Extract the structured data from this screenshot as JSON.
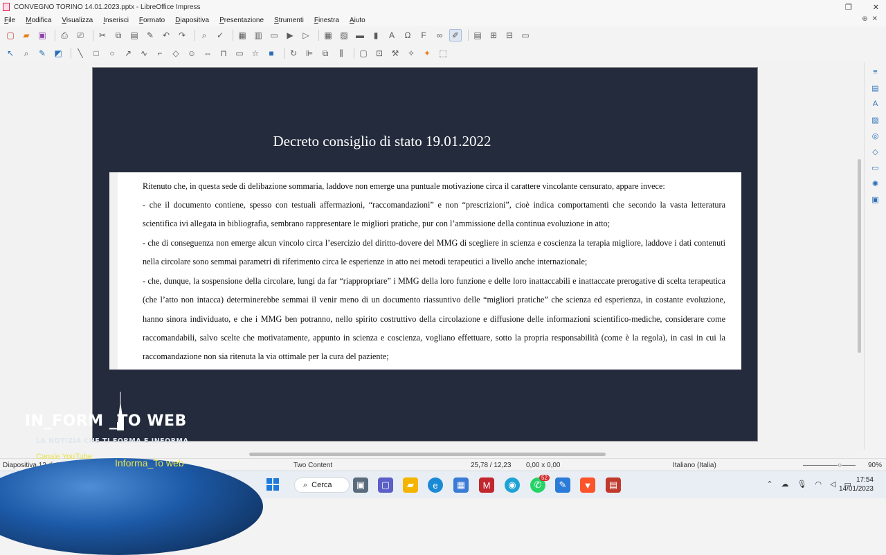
{
  "window": {
    "title": "CONVEGNO TORINO 14.01.2023.pptx - LibreOffice Impress",
    "controls": [
      "❐",
      "✕"
    ]
  },
  "menu": [
    "File",
    "Modifica",
    "Visualizza",
    "Inserisci",
    "Formato",
    "Diapositiva",
    "Presentazione",
    "Strumenti",
    "Finestra",
    "Aiuto"
  ],
  "slide": {
    "title": "Decreto consiglio di stato 19.01.2022",
    "paragraphs": [
      "Ritenuto che, in questa sede di delibazione sommaria, laddove non emerge una puntuale motivazione circa il carattere vincolante censurato, appare invece:",
      "- che il documento contiene, spesso con testuali affermazioni, “raccomandazioni” e non “prescrizioni”, cioè indica comportamenti che secondo la vasta letteratura scientifica ivi allegata in bibliografia, sembrano rappresentare le migliori pratiche, pur con l’ammissione della continua evoluzione in atto;",
      "- che di conseguenza non emerge alcun vincolo circa l’esercizio del diritto-dovere del MMG di scegliere in scienza e coscienza la terapia migliore, laddove i dati contenuti nella circolare sono semmai parametri di riferimento circa le esperienze in atto nei metodi terapeutici a livello anche internazionale;",
      "- che, dunque, la sospensione della circolare, lungi da far “riappropriare” i MMG della loro funzione e delle loro inattaccabili e inattaccate prerogative di scelta terapeutica (che l’atto non intacca) determinerebbe semmai il venir meno di un documento riassuntivo delle “migliori pratiche” che scienza ed esperienza, in costante evoluzione, hanno sinora individuato, e che i MMG ben potranno, nello spirito costruttivo della circolazione e diffusione delle informazioni scientifico-mediche, considerare come raccomandabili, salvo scelte che motivatamente, appunto in scienza e coscienza, vogliano effettuare, sotto la propria responsabilità (come è la regola), in casi in cui la raccomandazione non sia ritenuta la via ottimale per la cura del paziente;"
    ]
  },
  "status": {
    "slide_info": "Diapositiva 12 di 17",
    "layout": "Two Content",
    "position": "25,78 / 12,23",
    "size": "0,00 x 0,00",
    "language": "Italiano (Italia)",
    "zoom": "90%"
  },
  "taskbar": {
    "search_label": "Cerca",
    "badge": "52",
    "time": "17:54",
    "date": "14/01/2023"
  },
  "overlay": {
    "logo": "IN_FORM  _TO WEB",
    "tagline": "LA NOTIZIA CHE TI FORMA E INFORMA",
    "channel": "Canale YouTube:",
    "channel_name": "Informa_To web"
  },
  "colors": {
    "slide_background": "#242b3d",
    "overlay_text": "#e8e24a",
    "accent": "#2a6fb9"
  }
}
